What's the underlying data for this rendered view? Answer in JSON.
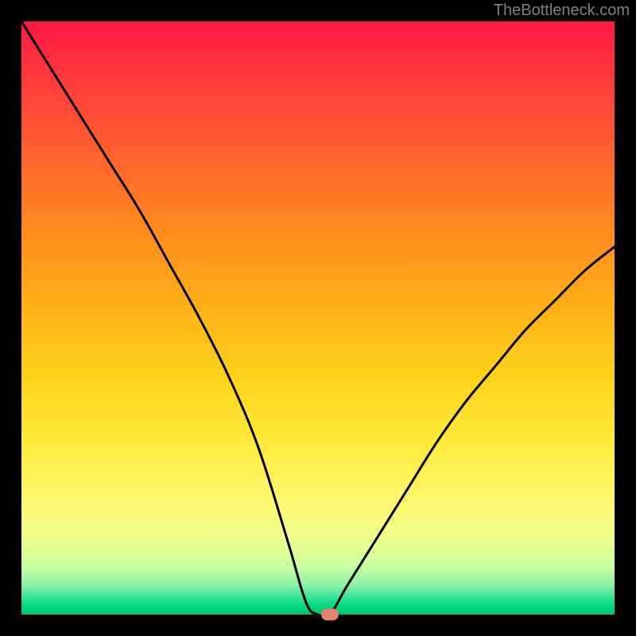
{
  "watermark": "TheBottleneck.com",
  "chart_data": {
    "type": "line",
    "title": "",
    "xlabel": "",
    "ylabel": "",
    "xlim": [
      0,
      100
    ],
    "ylim": [
      0,
      100
    ],
    "x": [
      0,
      5,
      10,
      15,
      20,
      25,
      30,
      35,
      40,
      45,
      48,
      50,
      52,
      55,
      60,
      65,
      70,
      75,
      80,
      85,
      90,
      95,
      100
    ],
    "y": [
      100,
      92,
      84,
      76,
      68,
      59,
      50,
      40,
      28,
      12,
      2,
      0,
      0,
      5,
      13,
      21,
      29,
      36,
      42,
      48,
      53,
      58,
      62
    ],
    "marker": {
      "x": 52,
      "y": 0
    },
    "gradient_colors": {
      "top": "#ff1744",
      "middle": "#ffd21a",
      "bottom": "#00c46f"
    }
  }
}
